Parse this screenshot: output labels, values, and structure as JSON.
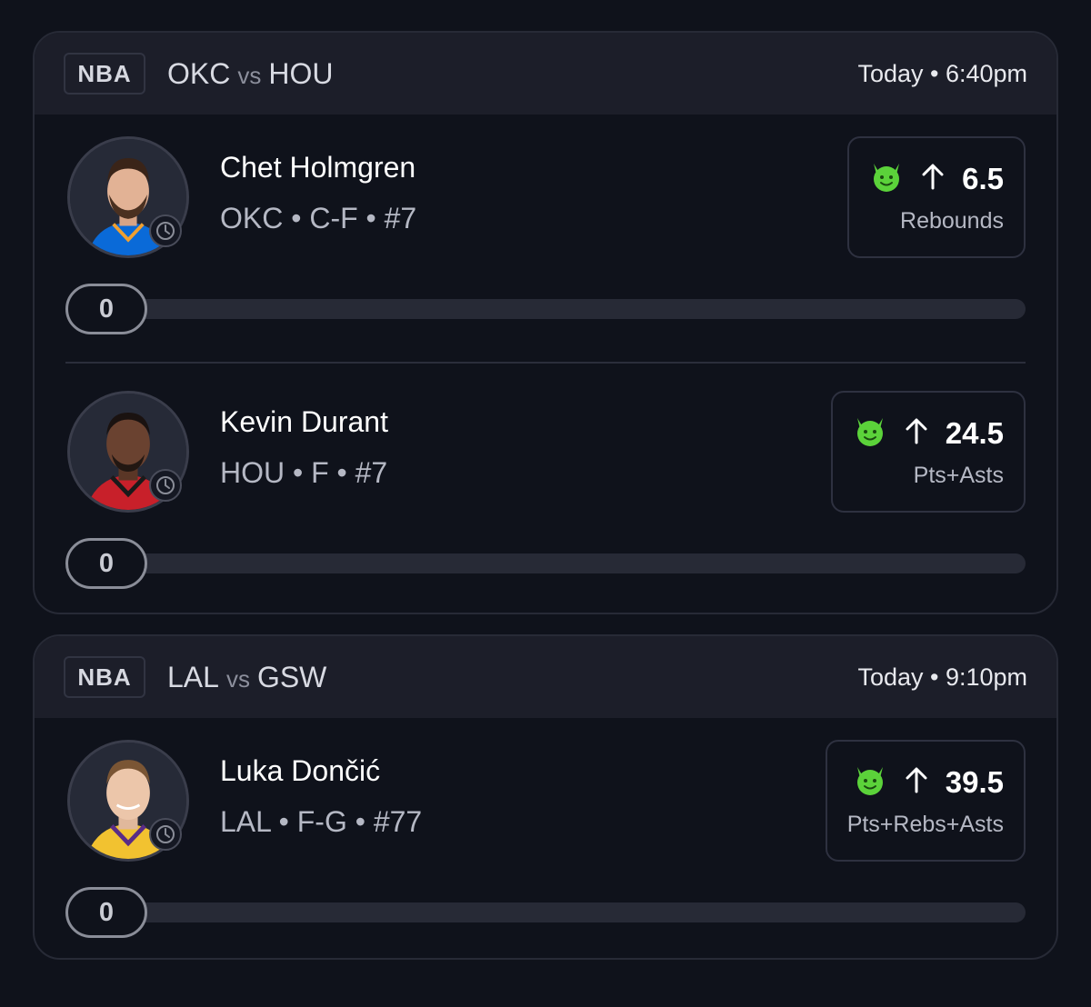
{
  "games": [
    {
      "league": "NBA",
      "home": "OKC",
      "vs": "vs",
      "away": "HOU",
      "time": "Today • 6:40pm",
      "players": [
        {
          "name": "Chet Holmgren",
          "meta": "OKC • C-F • #7",
          "line": "6.5",
          "stat": "Rebounds",
          "progress": "0",
          "jersey_color": "#0a6ad8",
          "jersey_trim": "#f0a030"
        },
        {
          "name": "Kevin Durant",
          "meta": "HOU • F • #7",
          "line": "24.5",
          "stat": "Pts+Asts",
          "progress": "0",
          "jersey_color": "#c8202a",
          "jersey_trim": "#1a1a1a"
        }
      ]
    },
    {
      "league": "NBA",
      "home": "LAL",
      "vs": "vs",
      "away": "GSW",
      "time": "Today • 9:10pm",
      "players": [
        {
          "name": "Luka Dončić",
          "meta": "LAL • F-G • #77",
          "line": "39.5",
          "stat": "Pts+Rebs+Asts",
          "progress": "0",
          "jersey_color": "#f2c230",
          "jersey_trim": "#5a2c86"
        }
      ]
    }
  ],
  "icons": {
    "demon": "green-demon-icon",
    "arrow": "arrow-up-icon",
    "clock": "clock-icon"
  },
  "colors": {
    "demon": "#5bd23a",
    "background": "#0f121b",
    "header": "#1c1e29"
  }
}
